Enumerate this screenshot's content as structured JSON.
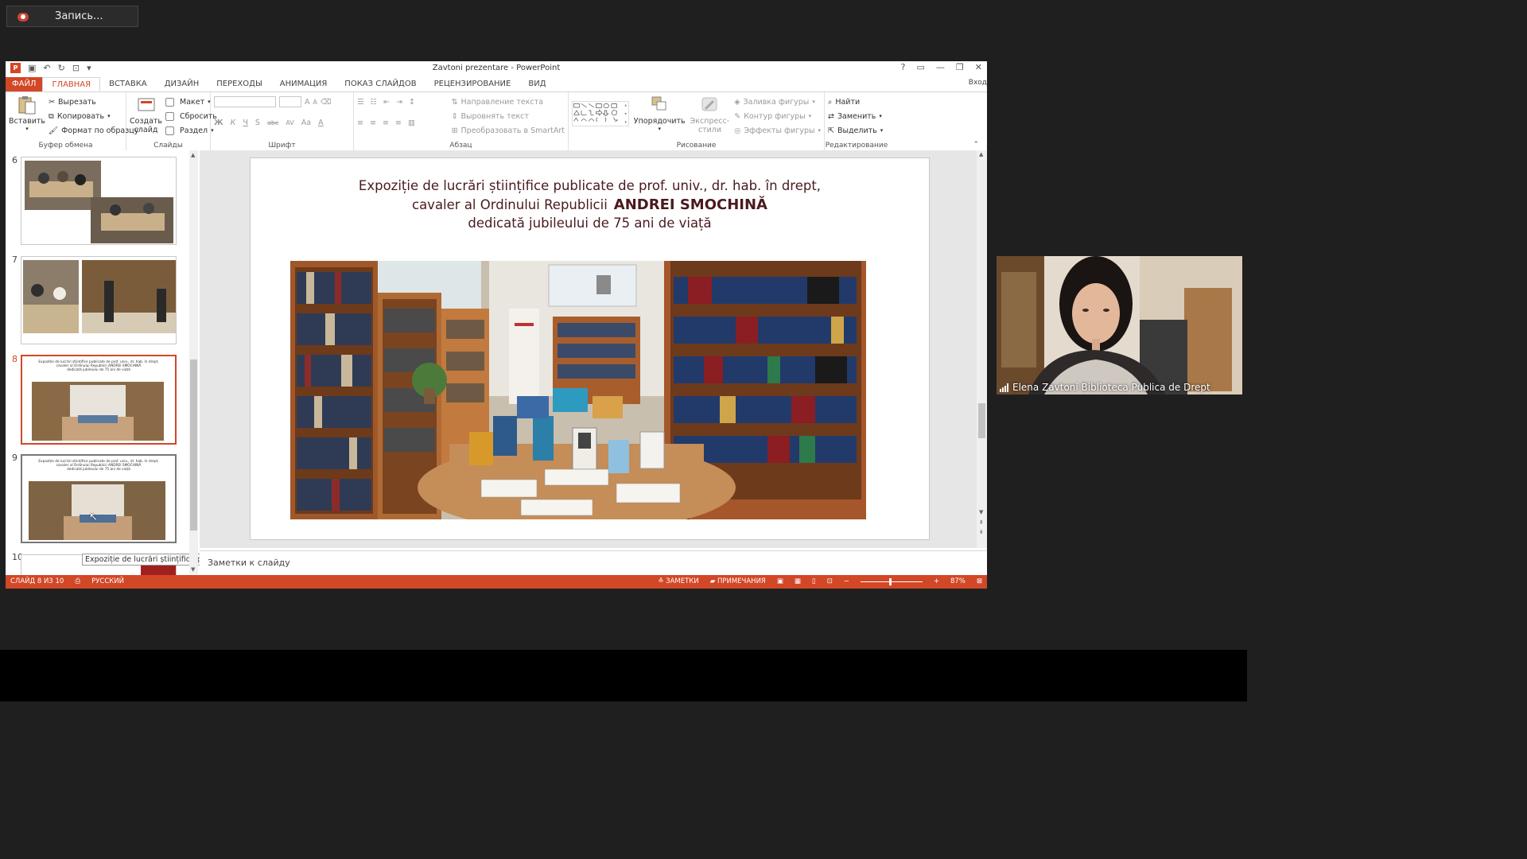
{
  "recording": {
    "label": "Запись..."
  },
  "window": {
    "title": "Zavtoni prezentare - PowerPoint",
    "controls": [
      "?",
      "▭",
      "—",
      "❐",
      "✕"
    ]
  },
  "tabs": [
    {
      "label": "ФАЙЛ"
    },
    {
      "label": "ГЛАВНАЯ"
    },
    {
      "label": "ВСТАВКА"
    },
    {
      "label": "ДИЗАЙН"
    },
    {
      "label": "ПЕРЕХОДЫ"
    },
    {
      "label": "АНИМАЦИЯ"
    },
    {
      "label": "ПОКАЗ СЛАЙДОВ"
    },
    {
      "label": "РЕЦЕНЗИРОВАНИЕ"
    },
    {
      "label": "ВИД"
    }
  ],
  "signin": "Вход",
  "ribbon": {
    "clipboard": {
      "paste": "Вставить",
      "cut": "Вырезать",
      "copy": "Копировать",
      "format_painter": "Формат по образцу",
      "label": "Буфер обмена"
    },
    "slides": {
      "new_slide_1": "Создать",
      "new_slide_2": "слайд",
      "layout": "Макет",
      "reset": "Сбросить",
      "section": "Раздел",
      "label": "Слайды"
    },
    "font": {
      "bold": "Ж",
      "italic": "К",
      "underline": "Ч",
      "shadow": "S",
      "strike": "abc",
      "spacing": "AV",
      "case": "Aa",
      "color": "A",
      "grow": "A",
      "shrink": "A",
      "label": "Шрифт"
    },
    "paragraph": {
      "text_direction": "Направление текста",
      "align_text": "Выровнять текст",
      "smartart": "Преобразовать в SmartArt",
      "label": "Абзац"
    },
    "drawing": {
      "arrange": "Упорядочить",
      "quick_styles_1": "Экспресс-",
      "quick_styles_2": "стили",
      "fill": "Заливка фигуры",
      "outline": "Контур фигуры",
      "effects": "Эффекты фигуры",
      "label": "Рисование"
    },
    "editing": {
      "find": "Найти",
      "replace": "Заменить",
      "select": "Выделить",
      "label": "Редактирование"
    }
  },
  "thumbnails": {
    "numbers": [
      "6",
      "7",
      "8",
      "9",
      "10"
    ],
    "mini_title_1": "Expoziție de lucrări științifice publicate de prof. univ., dr. hab. în drept,",
    "mini_title_2": "cavaler al Ordinului Republicii ANDREI SMOCHINĂ",
    "mini_title_3": "dedicată jubileului de 75 ani de viață",
    "tooltip": "Expoziție de lucrări științifice p..."
  },
  "slide": {
    "line1": "Expoziție de lucrări științifice publicate de prof. univ., dr. hab. în drept,",
    "line2a": "cavaler al Ordinului Republicii",
    "line2b": "ANDREI SMOCHINĂ",
    "line3": "dedicată jubileului de 75 ani de viață"
  },
  "notes_placeholder": "Заметки к слайду",
  "status": {
    "slide_counter": "СЛАЙД 8 ИЗ 10",
    "language": "РУССКИЙ",
    "notes": "ЗАМЕТКИ",
    "comments": "ПРИМЕЧАНИЯ",
    "zoom": "87%"
  },
  "webcam": {
    "name": "Elena Zavtoni Biblioteca Publica de Drept"
  },
  "colors": {
    "accent": "#d24726",
    "title_text": "#4a1a1e",
    "background": "#1f1f1f"
  }
}
